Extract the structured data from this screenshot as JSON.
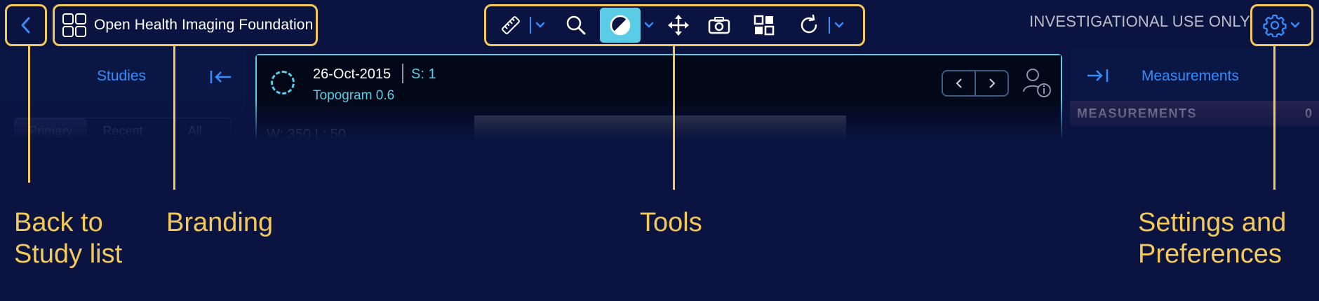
{
  "header": {
    "brand_name": "Open Health Imaging Foundation",
    "investigational_notice": "INVESTIGATIONAL USE ONLY",
    "tools": [
      {
        "icon": "ruler-icon",
        "has_dropdown": true
      },
      {
        "icon": "zoom-icon",
        "has_dropdown": false
      },
      {
        "icon": "window-level-icon",
        "has_dropdown": true,
        "active": true
      },
      {
        "icon": "pan-icon",
        "has_dropdown": false
      },
      {
        "icon": "capture-icon",
        "has_dropdown": false
      },
      {
        "icon": "layout-icon",
        "has_dropdown": false
      },
      {
        "icon": "rotate-icon",
        "has_dropdown": true
      }
    ]
  },
  "left_panel": {
    "title": "Studies",
    "tabs": [
      "Primary",
      "Recent",
      "All"
    ],
    "selected_tab": "Primary"
  },
  "viewport": {
    "study_date": "26-Oct-2015",
    "series": "S: 1",
    "description": "Topogram 0.6",
    "window_level": "W: 350 L: 50"
  },
  "right_panel": {
    "title": "Measurements",
    "section_title": "MEASUREMENTS",
    "count": "0"
  },
  "annotations": {
    "back": "Back to\nStudy list",
    "branding": "Branding",
    "tools": "Tools",
    "settings": "Settings and\nPreferences"
  },
  "colors": {
    "background": "#0b1440",
    "callout": "#f3c95a",
    "accent": "#348cfd",
    "active_tool": "#5acce6"
  }
}
